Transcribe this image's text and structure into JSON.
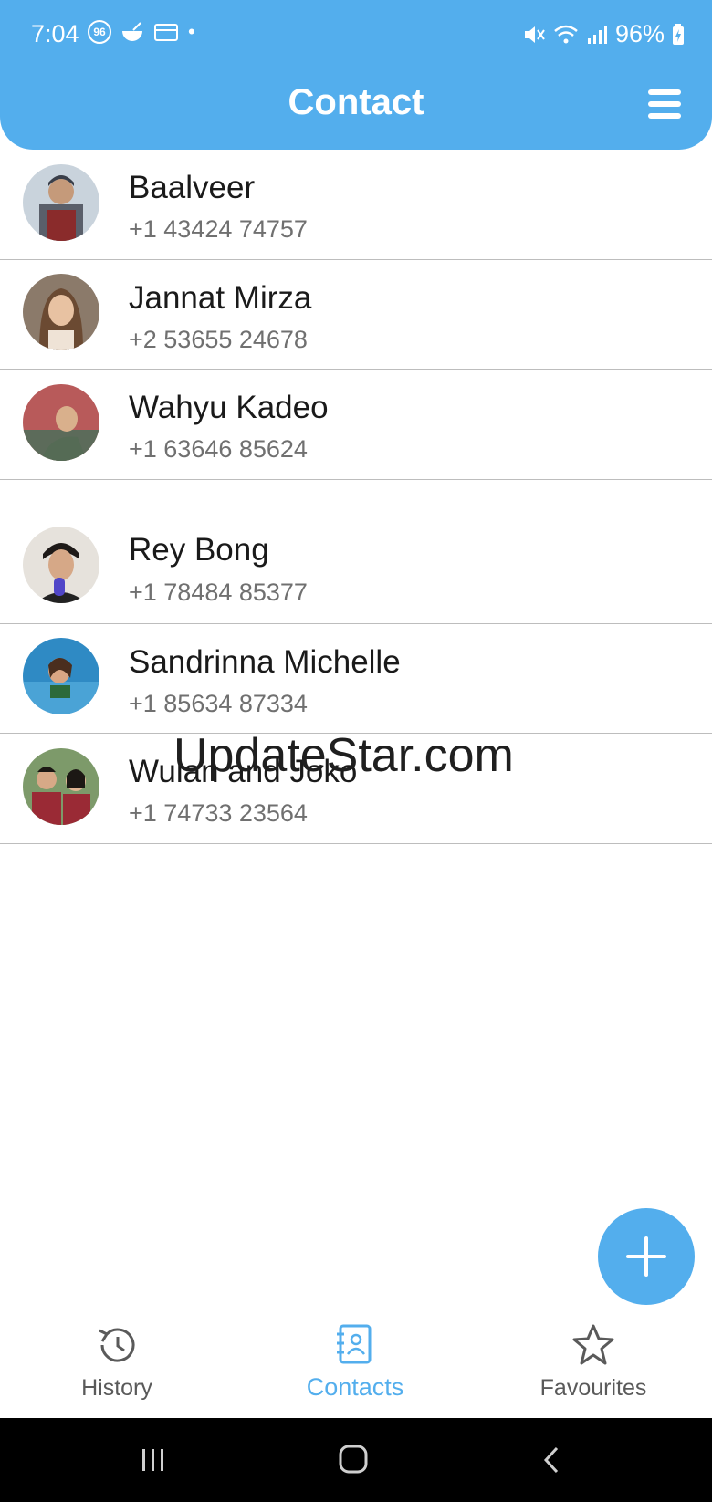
{
  "status_bar": {
    "time": "7:04",
    "badge": "96",
    "battery": "96%"
  },
  "header": {
    "title": "Contact",
    "menu_icon": "hamburger-menu-icon"
  },
  "contacts": [
    {
      "name": "Baalveer",
      "phone": "+1 43424 74757"
    },
    {
      "name": "Jannat Mirza",
      "phone": "+2 53655 24678"
    },
    {
      "name": "Wahyu Kadeo",
      "phone": "+1 63646 85624"
    },
    {
      "name": "Rey Bong",
      "phone": "+1 78484 85377"
    },
    {
      "name": "Sandrinna Michelle",
      "phone": "+1 85634 87334"
    },
    {
      "name": "Wulan and Joko",
      "phone": "+1 74733 23564"
    }
  ],
  "watermark": "UpdateStar.com",
  "fab": {
    "icon": "plus-icon"
  },
  "bottom_nav": {
    "items": [
      {
        "label": "History",
        "icon": "history-icon"
      },
      {
        "label": "Contacts",
        "icon": "contacts-book-icon"
      },
      {
        "label": "Favourites",
        "icon": "star-icon"
      }
    ],
    "active": "Contacts"
  },
  "colors": {
    "accent": "#53aeed",
    "divider": "#bdbdbd",
    "phone_text": "#707070"
  }
}
